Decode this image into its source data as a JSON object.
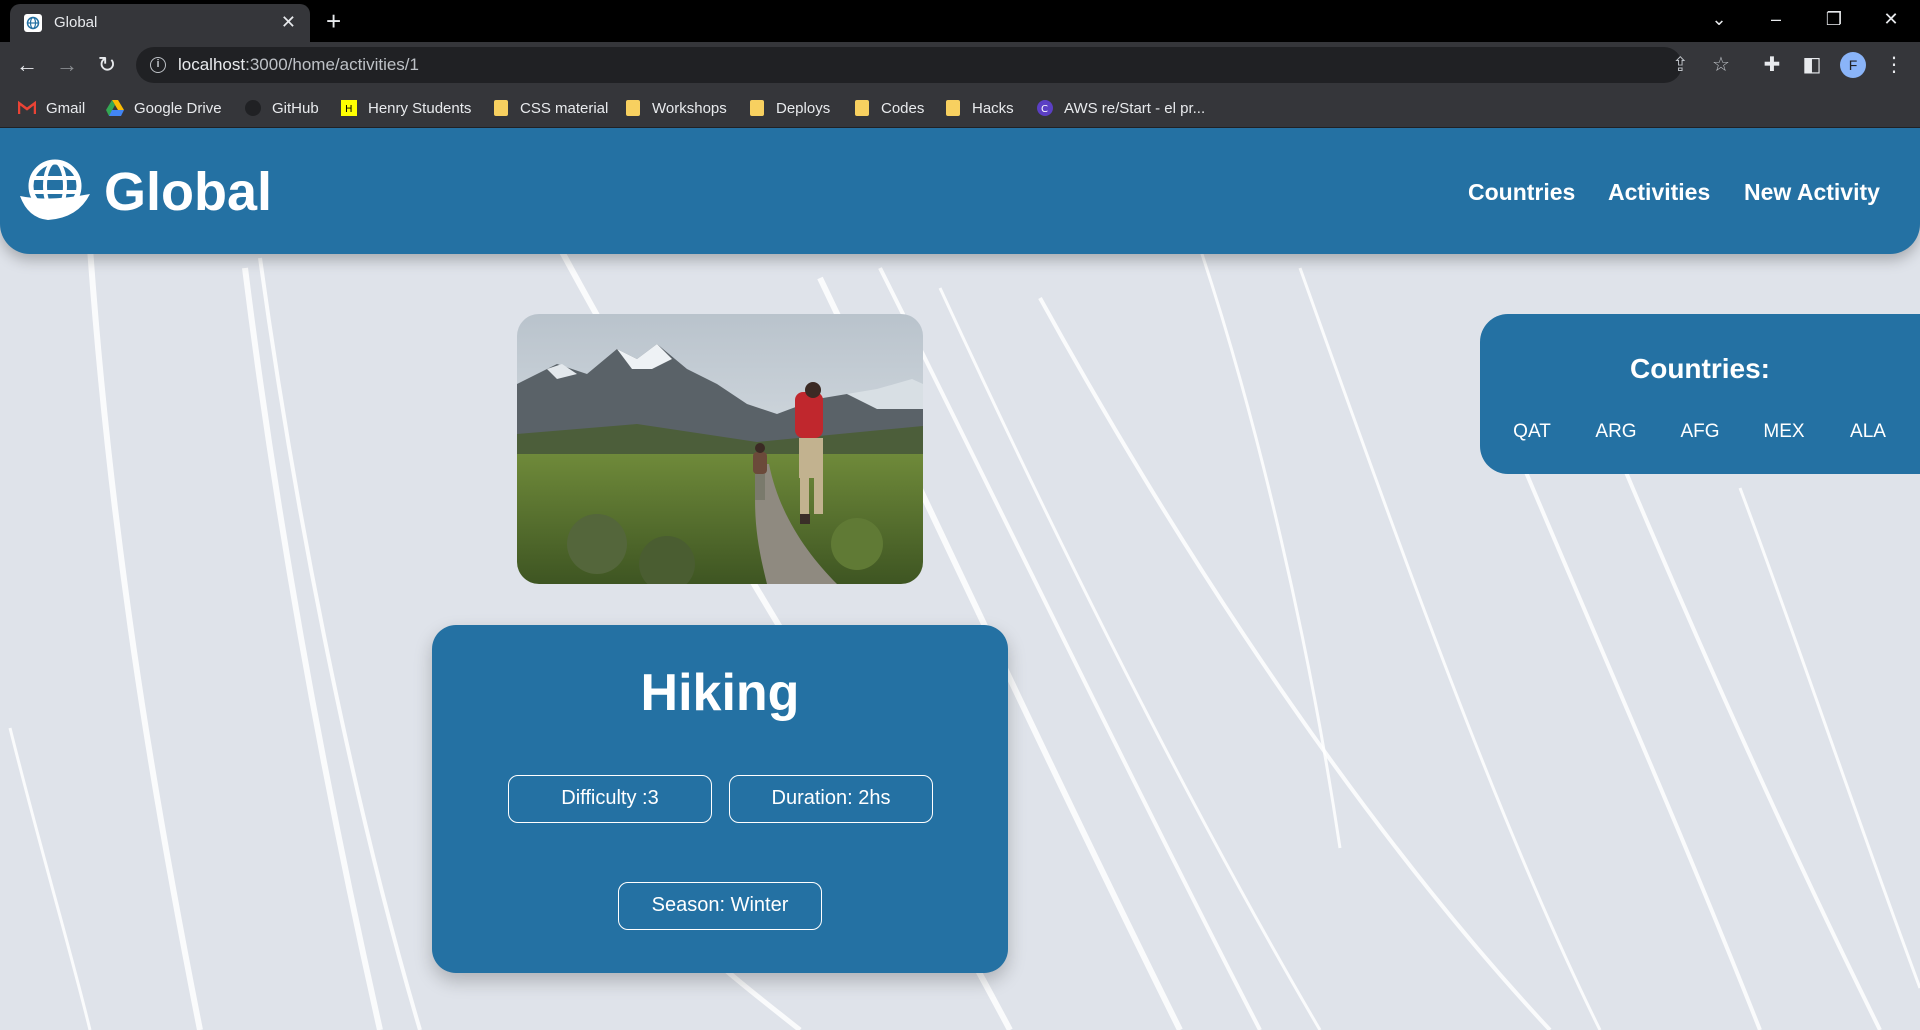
{
  "browser": {
    "tab_title": "Global",
    "tab_close": "✕",
    "new_tab": "+",
    "url_host": "localhost",
    "url_path": ":3000/home/activities/1",
    "profile_initial": "F",
    "bookmarks": [
      "Gmail",
      "Google Drive",
      "GitHub",
      "Henry Students",
      "CSS material",
      "Workshops",
      "Deploys",
      "Codes",
      "Hacks",
      "AWS re/Start - el pr..."
    ]
  },
  "header": {
    "logo_text": "Global",
    "nav": [
      "Countries",
      "Activities",
      "New Activity"
    ]
  },
  "activity": {
    "name": "Hiking",
    "difficulty": "Difficulty :3",
    "duration": "Duration: 2hs",
    "season": "Season: Winter"
  },
  "countries_panel": {
    "title": "Countries:",
    "codes": [
      "QAT",
      "ARG",
      "AFG",
      "MEX",
      "ALA"
    ]
  },
  "colors": {
    "brand": "#2471a3",
    "page_bg": "#dfe3ea",
    "chrome_dark": "#35363a"
  }
}
